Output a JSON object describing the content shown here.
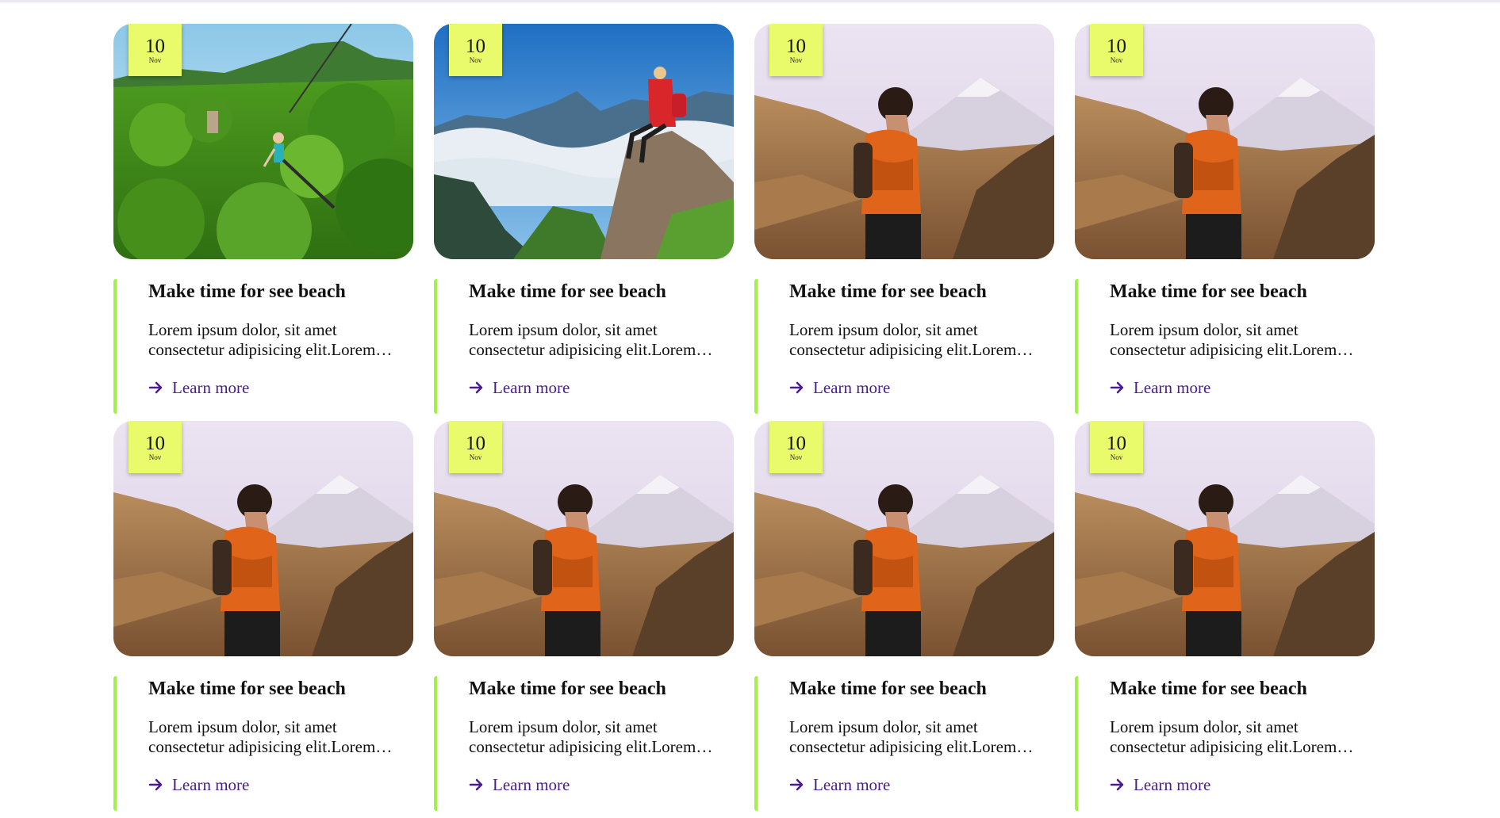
{
  "cards": [
    {
      "day": "10",
      "month": "Nov",
      "title": "Make time for see beach",
      "excerpt": "Lorem ipsum dolor, sit amet consectetur adipisicing elit.Lorem ipsum dolor sit amet.",
      "cta": "Learn more",
      "image": "zipline-jungle"
    },
    {
      "day": "10",
      "month": "Nov",
      "title": "Make time for see beach",
      "excerpt": "Lorem ipsum dolor, sit amet consectetur adipisicing elit.Lorem ipsum dolor sit amet.",
      "cta": "Learn more",
      "image": "hiker-mountain-clouds"
    },
    {
      "day": "10",
      "month": "Nov",
      "title": "Make time for see beach",
      "excerpt": "Lorem ipsum dolor, sit amet consectetur adipisicing elit.Lorem ipsum dolor sit amet.",
      "cta": "Learn more",
      "image": "woman-volcano-view"
    },
    {
      "day": "10",
      "month": "Nov",
      "title": "Make time for see beach",
      "excerpt": "Lorem ipsum dolor, sit amet consectetur adipisicing elit.Lorem ipsum dolor sit amet.",
      "cta": "Learn more",
      "image": "woman-volcano-view"
    },
    {
      "day": "10",
      "month": "Nov",
      "title": "Make time for see beach",
      "excerpt": "Lorem ipsum dolor, sit amet consectetur adipisicing elit.Lorem ipsum dolor sit amet.",
      "cta": "Learn more",
      "image": "woman-volcano-view"
    },
    {
      "day": "10",
      "month": "Nov",
      "title": "Make time for see beach",
      "excerpt": "Lorem ipsum dolor, sit amet consectetur adipisicing elit.Lorem ipsum dolor sit amet.",
      "cta": "Learn more",
      "image": "woman-volcano-view"
    },
    {
      "day": "10",
      "month": "Nov",
      "title": "Make time for see beach",
      "excerpt": "Lorem ipsum dolor, sit amet consectetur adipisicing elit.Lorem ipsum dolor sit amet.",
      "cta": "Learn more",
      "image": "woman-volcano-view"
    },
    {
      "day": "10",
      "month": "Nov",
      "title": "Make time for see beach",
      "excerpt": "Lorem ipsum dolor, sit amet consectetur adipisicing elit.Lorem ipsum dolor sit amet.",
      "cta": "Learn more",
      "image": "woman-volcano-view"
    }
  ],
  "colors": {
    "badge": "#e9fb6b",
    "accent_border": "#a2f04a",
    "link": "#4a1d8c"
  },
  "icons": {
    "cta": "arrow-right-icon"
  }
}
